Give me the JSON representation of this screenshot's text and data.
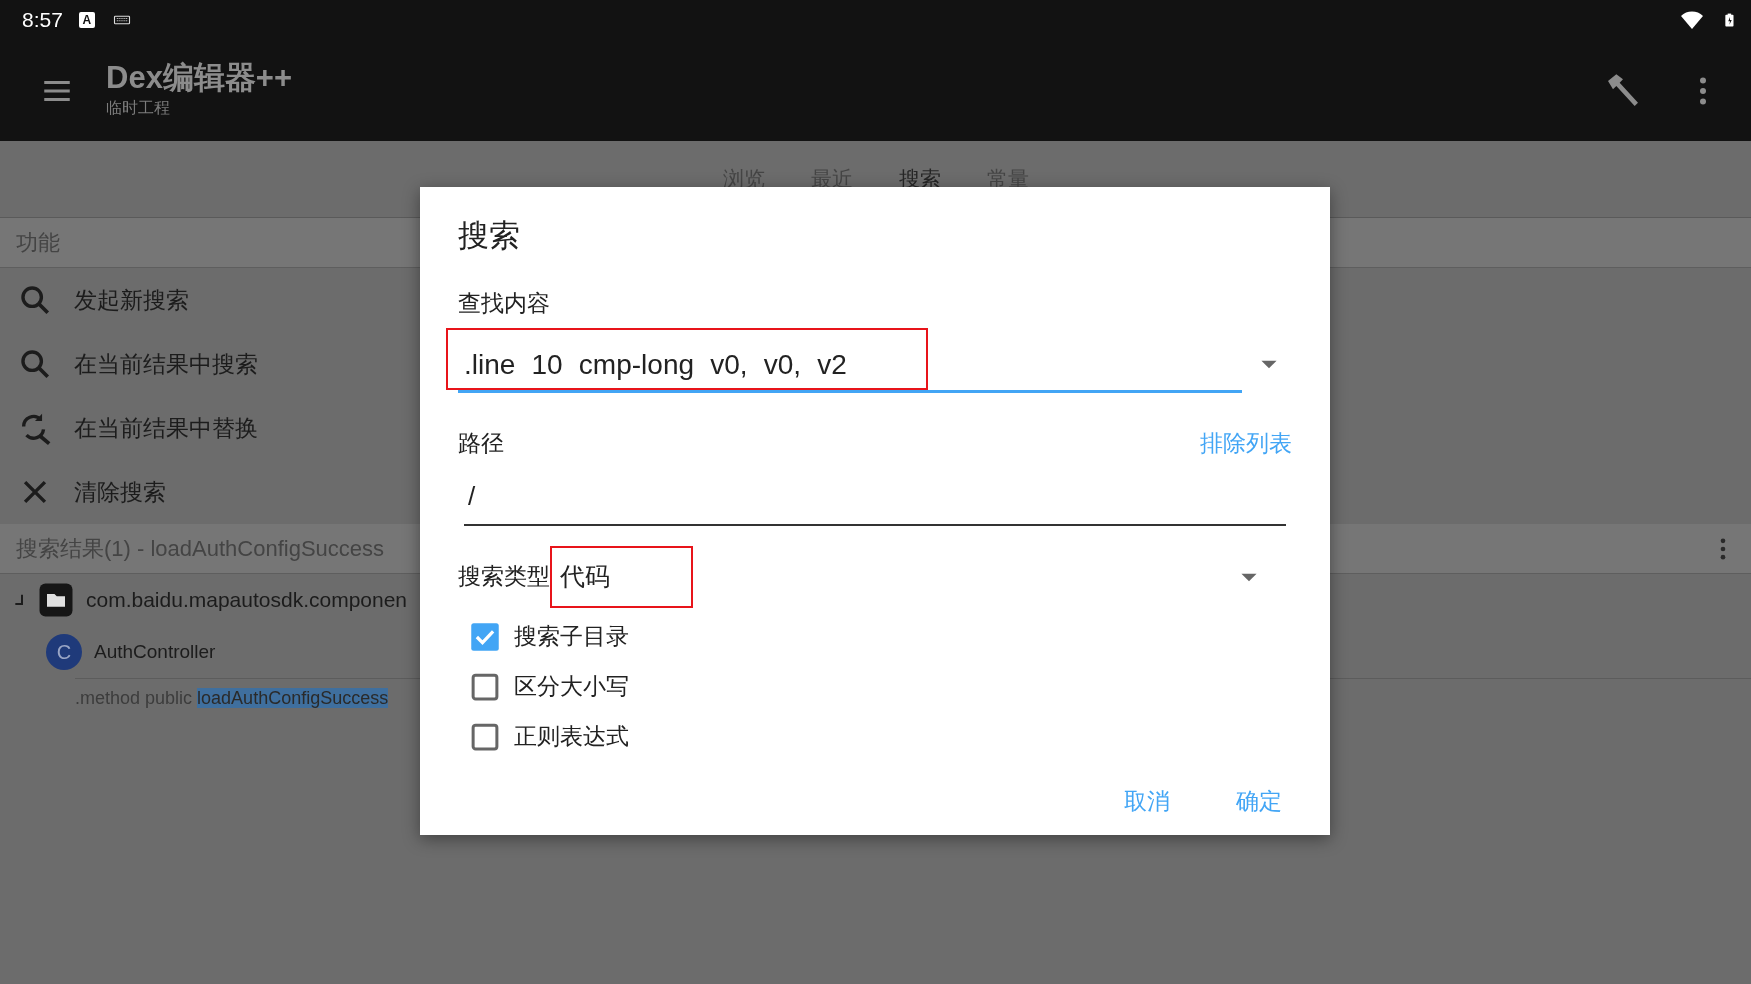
{
  "status_bar": {
    "time": "8:57",
    "badge": "A"
  },
  "app_bar": {
    "title": "Dex编辑器++",
    "subtitle": "临时工程"
  },
  "tabs": [
    {
      "label": "浏览",
      "selected": false
    },
    {
      "label": "最近",
      "selected": false
    },
    {
      "label": "搜索",
      "selected": true
    },
    {
      "label": "常量",
      "selected": false
    }
  ],
  "functions": {
    "header": "功能",
    "items": [
      {
        "kind": "search",
        "label": "发起新搜索"
      },
      {
        "kind": "search",
        "label": "在当前结果中搜索"
      },
      {
        "kind": "replace",
        "label": "在当前结果中替换"
      },
      {
        "kind": "close",
        "label": "清除搜索"
      }
    ]
  },
  "results": {
    "header": "搜索结果(1) - loadAuthConfigSuccess",
    "tree": [
      {
        "kind": "package",
        "label": "com.baidu.mapautosdk.componen",
        "children": [
          {
            "kind": "class",
            "badge": "C",
            "label": "AuthController",
            "children": [
              {
                "kind": "method",
                "prefix": ".method public ",
                "match": "loadAuthConfigSuccess"
              }
            ]
          }
        ]
      }
    ]
  },
  "dialog": {
    "title": "搜索",
    "find": {
      "label": "查找内容",
      "value": ".line 10 cmp-long v0, v0, v2",
      "highlighted": true
    },
    "path": {
      "label": "路径",
      "link": "排除列表",
      "value": "/"
    },
    "type": {
      "label": "搜索类型",
      "value": "代码",
      "highlighted": true
    },
    "options": [
      {
        "label": "搜索子目录",
        "checked": true
      },
      {
        "label": "区分大小写",
        "checked": false
      },
      {
        "label": "正则表达式",
        "checked": false
      }
    ],
    "buttons": [
      "取消",
      "确定"
    ]
  }
}
